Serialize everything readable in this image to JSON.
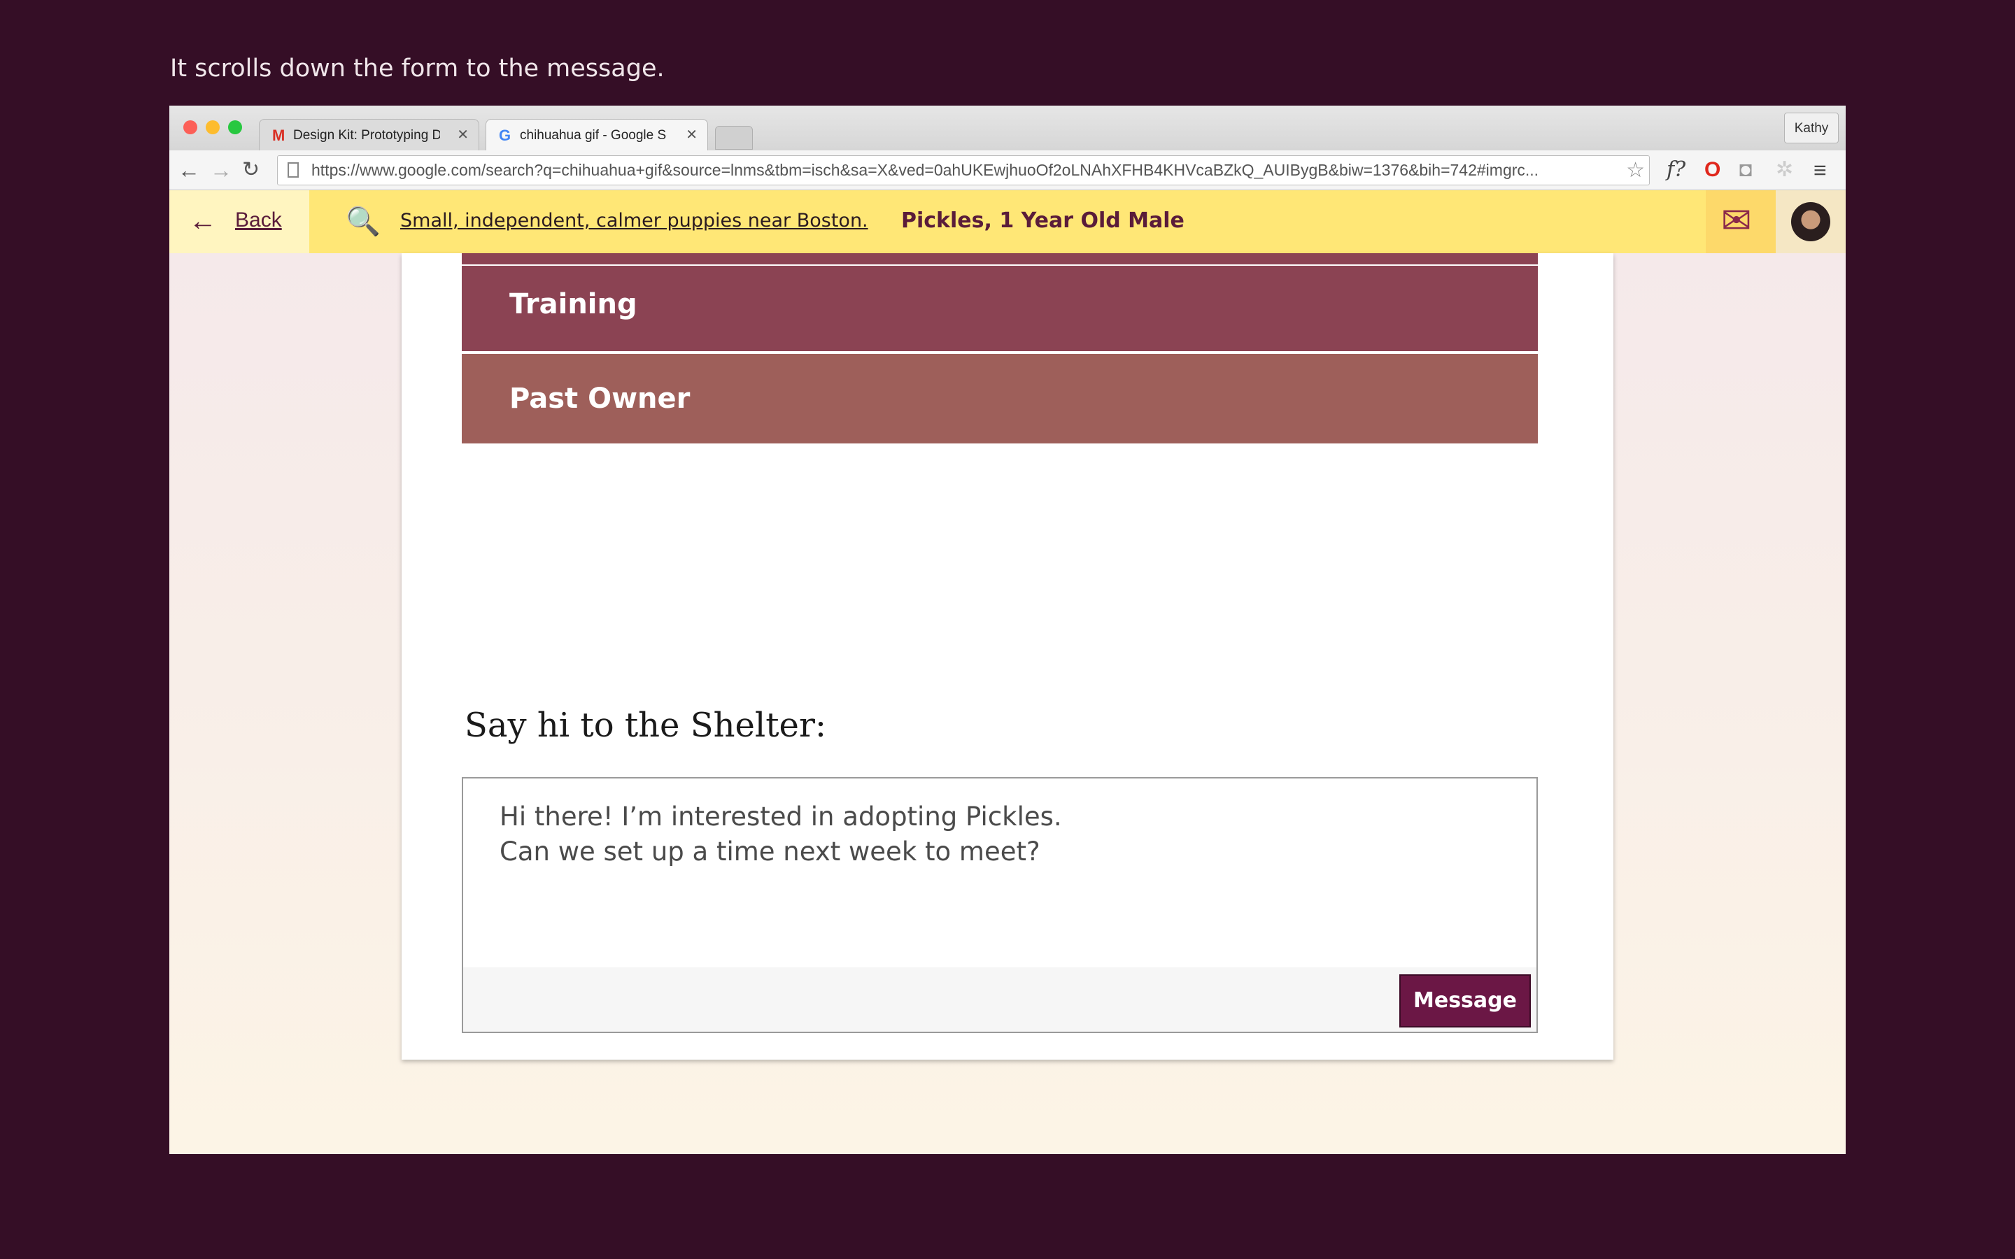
{
  "caption": "It scrolls down the form to the message.",
  "browser": {
    "tabs": [
      {
        "label": "Design Kit: Prototyping Da",
        "favicon": "gmail-icon"
      },
      {
        "label": "chihuahua gif - Google Sea",
        "favicon": "google-icon"
      }
    ],
    "profile": "Kathy",
    "url": "https://www.google.com/search?q=chihuahua+gif&source=lnms&tbm=isch&sa=X&ved=0ahUKEwjhuoOf2oLNAhXFHB4KHVcaBZkQ_AUIBygB&biw=1376&bih=742#imgrc...",
    "ext_f": "f?"
  },
  "header": {
    "back_label": "Back",
    "search_text": "Small, independent, calmer puppies near Boston.",
    "dog_title": "Pickles, 1 Year Old Male"
  },
  "sections": {
    "training": "Training",
    "past_owner": "Past Owner"
  },
  "message": {
    "heading": "Say hi to the Shelter:",
    "line1": "Hi there! I’m interested in adopting Pickles.",
    "line2": "Can we set up a time next week to meet?",
    "button": "Message"
  }
}
